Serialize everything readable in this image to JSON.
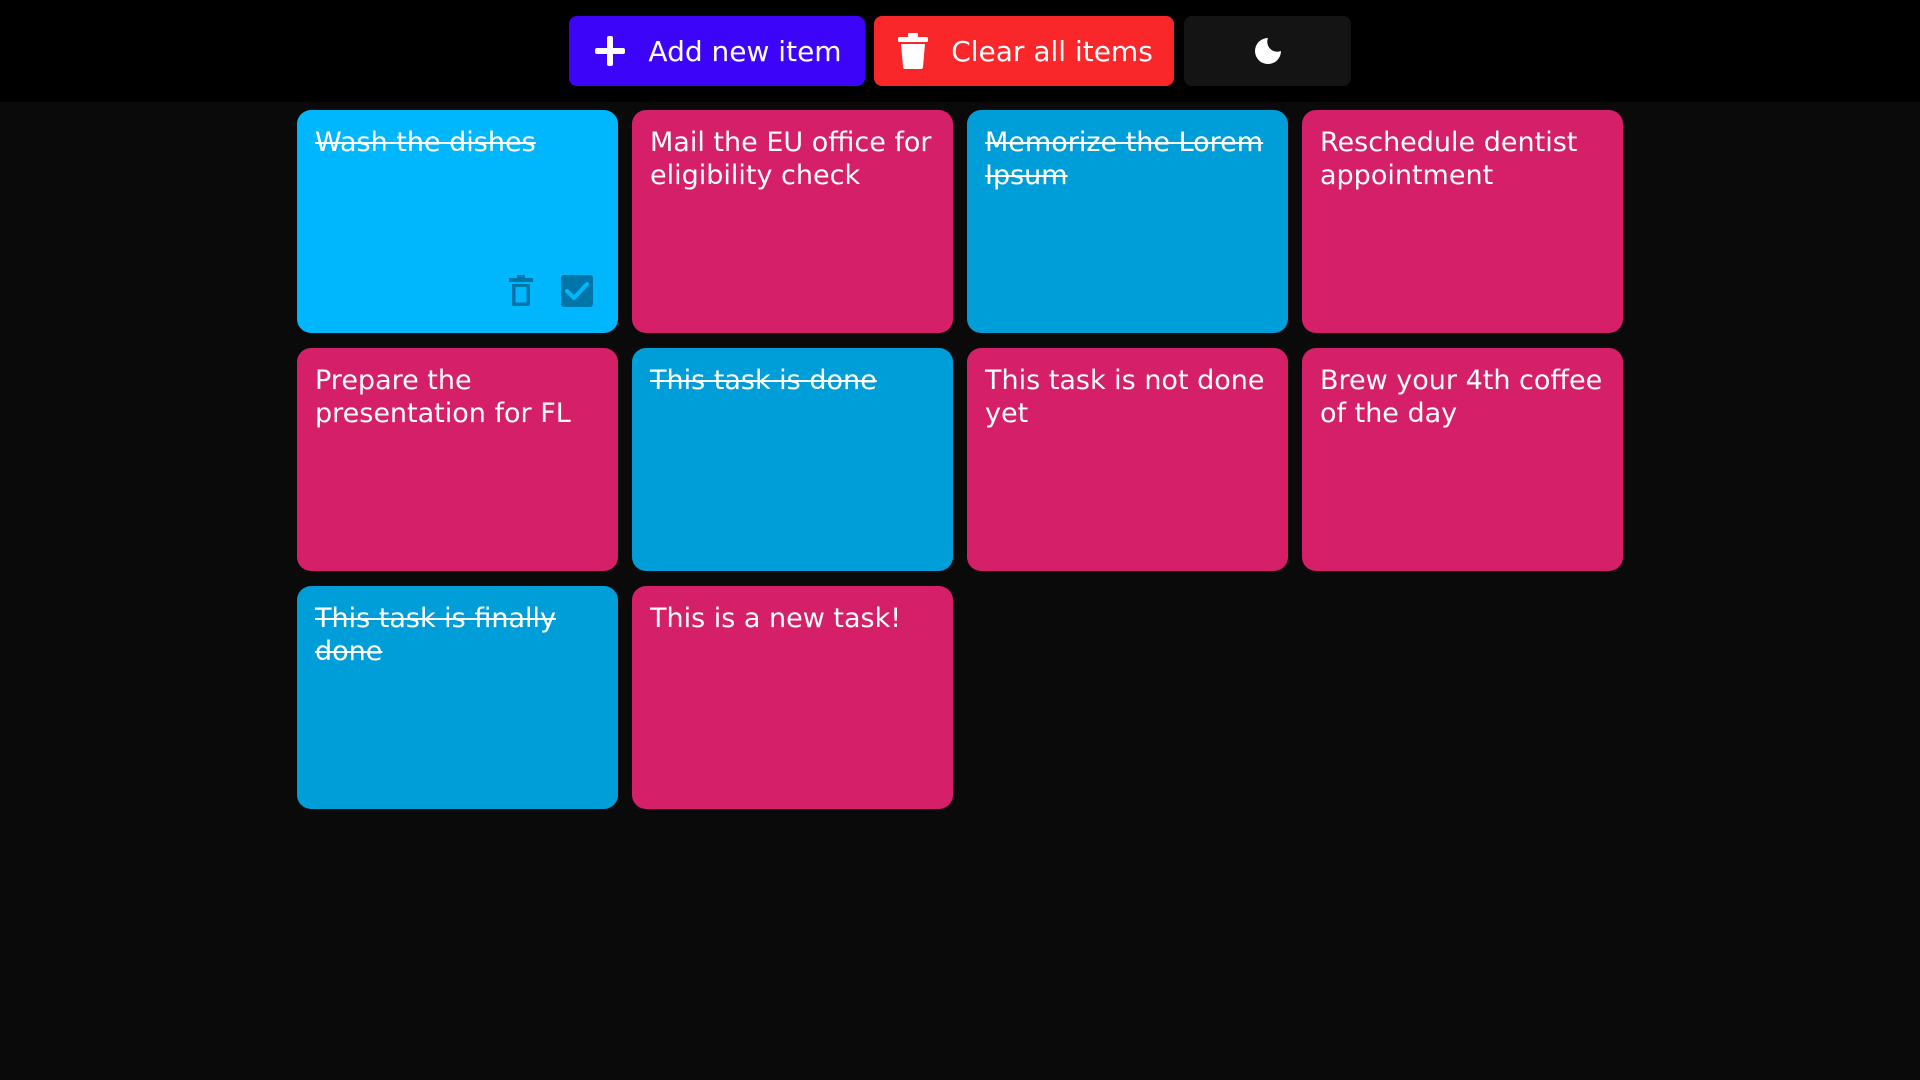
{
  "toolbar": {
    "add_label": "Add new item",
    "add_icon": "plus-icon",
    "add_color": "#3d04fa",
    "clear_label": "Clear all items",
    "clear_icon": "trash-icon",
    "clear_color": "#f9262a",
    "theme_icon": "moon-icon",
    "theme_color": "#141414"
  },
  "colors": {
    "done_card": "#009ed8",
    "done_card_hover": "#00b7fe",
    "pending_card": "#d61f69",
    "page_background": "#0a0a0a",
    "toolbar_background": "#000000"
  },
  "tasks": [
    {
      "text": "Wash the dishes",
      "done": true,
      "hovered": true
    },
    {
      "text": "Mail the EU office for eligibility check",
      "done": false
    },
    {
      "text": "Memorize the Lorem Ipsum",
      "done": true
    },
    {
      "text": "Reschedule dentist appointment",
      "done": false
    },
    {
      "text": "Prepare the presentation for FL",
      "done": false
    },
    {
      "text": "This task is done",
      "done": true
    },
    {
      "text": "This task is not done yet",
      "done": false
    },
    {
      "text": "Brew your 4th coffee of the day",
      "done": false
    },
    {
      "text": "This task is finally done",
      "done": true
    },
    {
      "text": "This is a new task!",
      "done": false
    }
  ],
  "card_actions": {
    "delete_icon": "trash-icon",
    "check_icon": "checkbox-checked-icon"
  }
}
